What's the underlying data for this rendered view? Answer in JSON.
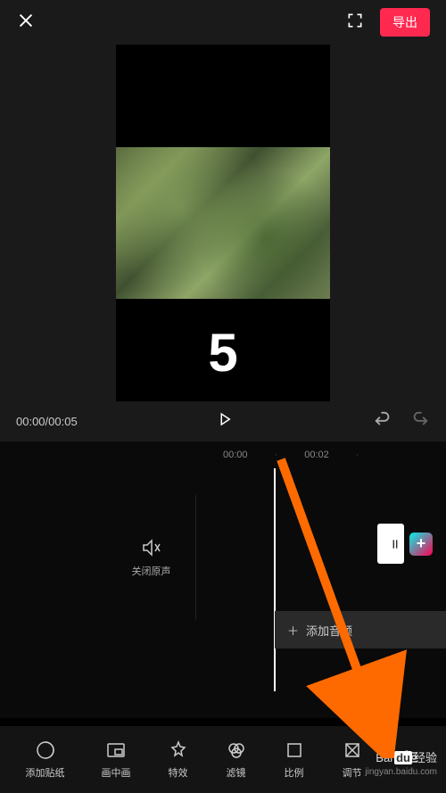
{
  "header": {
    "export_label": "导出"
  },
  "preview": {
    "countdown": "5"
  },
  "controls": {
    "timecode": "00:00/00:05"
  },
  "timeline": {
    "marks": [
      "00:00",
      "·",
      "00:02",
      "·"
    ],
    "mute_label": "关闭原声",
    "add_audio_label": "添加音频"
  },
  "toolbar": {
    "items": [
      {
        "label": "添加贴纸"
      },
      {
        "label": "画中画"
      },
      {
        "label": "特效"
      },
      {
        "label": "滤镜"
      },
      {
        "label": "比例"
      },
      {
        "label": "调节"
      }
    ]
  },
  "watermark": {
    "brand_plain": "Bai",
    "brand_box": "du",
    "brand_suffix": "经验",
    "url": "jingyan.baidu.com"
  },
  "icons": {
    "plus": "+",
    "audio_plus": "＋",
    "adjust_last": "⚙"
  }
}
